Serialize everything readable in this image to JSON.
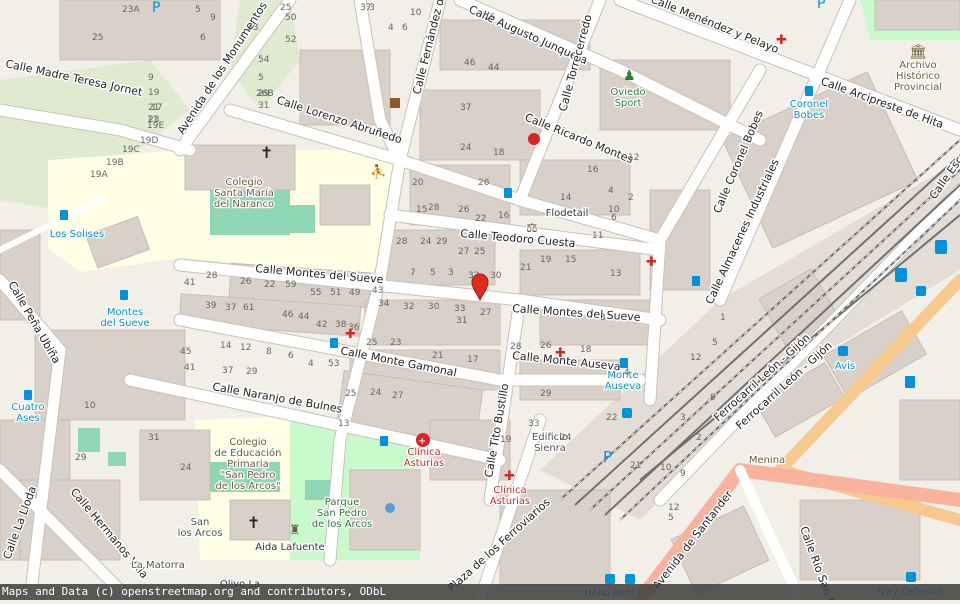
{
  "map": {
    "attribution": "Maps and Data (c) openstreetmap.org and contributors, ODbL",
    "marker": {
      "color": "#e02a1f"
    },
    "colors": {
      "background": "#f2efe9",
      "building": "#d9d0c9",
      "road": "#ffffff",
      "park": "#c8facc",
      "school": "#ffffe5",
      "railway_area": "#e8e0d8",
      "primary_road": "#fcd6a4",
      "trunk_road": "#f9b29c",
      "transit_blue": "#0092da",
      "health_red": "#d62727",
      "shop_purple": "#ac39ac"
    },
    "streets": [
      "Calle Madre Teresa Jornet",
      "Avenida de los Monumentos",
      "Calle Lorenzo Abruñedo",
      "Calle Fernández de",
      "Calle Augusto Junquera",
      "Calle Menéndez y Pelayo",
      "Calle Torrecerredo",
      "Calle Arcipreste de Hita",
      "Calle Ricardo Montes",
      "Calle Coronel Bobes",
      "Calle Almacenes Industriales",
      "Calle Teodoro Cuesta",
      "Calle Montes del Sueve",
      "Calle Montes del Sueve",
      "Calle Monte Gamonal",
      "Calle Monte Auseva",
      "Calle Naranjo de Bulnes",
      "Calle Tito Bustillo",
      "Calle Peña Ubiña",
      "Calle Hermanos Villa",
      "Calle Río San Pedro",
      "Avenida de Santander",
      "Plaza de los Ferroviarios",
      "Ferrocarril León - Gijón",
      "Ferrocarril León - Gijón",
      "Calle La Lloda",
      "Calle Escuela"
    ],
    "pois": [
      {
        "label": "Colegio\nSanta María\ndel Naranco",
        "color": "#6d5d3a"
      },
      {
        "label": "Los Solises",
        "color": "#0092da"
      },
      {
        "label": "Montes\ndel Sueve",
        "color": "#0092da"
      },
      {
        "label": "Cuatro\nAses",
        "color": "#0092da"
      },
      {
        "label": "Colegio\nde Educación\nPrimaria\n\"San Pedro\nde los Arcos\"",
        "color": "#6d5d3a"
      },
      {
        "label": "Parque\nSan Pedro\nde los Arcos",
        "color": "#2e7d32"
      },
      {
        "label": "Aida Lafuente",
        "color": "#333333"
      },
      {
        "label": "San\nlos Arcos",
        "color": "#555555"
      },
      {
        "label": "La Matorra",
        "color": "#555555"
      },
      {
        "label": "Clínica\nAsturias",
        "color": "#d62727"
      },
      {
        "label": "Clínica\nAsturias",
        "color": "#d62727"
      },
      {
        "label": "Edificio\nSienra",
        "color": "#555555"
      },
      {
        "label": "Flodetail",
        "color": "#333333"
      },
      {
        "label": "Oviedo\nSport",
        "color": "#2e7d32"
      },
      {
        "label": "Coronel\nBobes",
        "color": "#0092da"
      },
      {
        "label": "Archivo\nHistórico\nProvincial",
        "color": "#6d5d3a"
      },
      {
        "label": "Monte\nAuseva",
        "color": "#0092da"
      },
      {
        "label": "Avis",
        "color": "#0092da"
      },
      {
        "label": "Menina",
        "color": "#6d5d3a"
      },
      {
        "label": "Hello Rent",
        "color": "#0092da"
      },
      {
        "label": "Fray Ceferino",
        "color": "#0092da"
      },
      {
        "label": "Olivo La",
        "color": "#333333"
      }
    ],
    "house_numbers": [
      "23A",
      "5",
      "6",
      "25",
      "9",
      "50",
      "52",
      "54",
      "5",
      "29",
      "31",
      "26B",
      "33",
      "37",
      "4",
      "6",
      "3",
      "10",
      "46",
      "44",
      "15",
      "19",
      "21",
      "23",
      "25",
      "9",
      "17",
      "11",
      "19E",
      "19D",
      "19C",
      "19B",
      "19A",
      "37",
      "24",
      "18",
      "20",
      "28",
      "26",
      "22",
      "16",
      "14",
      "10",
      "6",
      "2",
      "4",
      "12",
      "16",
      "15",
      "26",
      "28",
      "24",
      "29",
      "27",
      "25",
      "21",
      "19",
      "15",
      "13",
      "11",
      "7",
      "5",
      "3",
      "32",
      "30",
      "28",
      "26",
      "22",
      "59",
      "55",
      "51",
      "49",
      "43",
      "41",
      "39",
      "37",
      "61",
      "46",
      "44",
      "42",
      "38",
      "36",
      "34",
      "32",
      "30",
      "33",
      "31",
      "27",
      "25",
      "23",
      "21",
      "17",
      "28",
      "26",
      "18",
      "14",
      "12",
      "8",
      "6",
      "4",
      "53",
      "45",
      "41",
      "37",
      "29",
      "27",
      "24",
      "25",
      "13",
      "33",
      "31",
      "29",
      "24",
      "10",
      "29",
      "22",
      "24",
      "19",
      "21",
      "12",
      "10",
      "9",
      "3",
      "2",
      "9",
      "12",
      "5",
      "1",
      "3",
      "4",
      "5",
      "2",
      "4",
      "6",
      "5",
      "7",
      "17",
      "14",
      "1"
    ]
  }
}
